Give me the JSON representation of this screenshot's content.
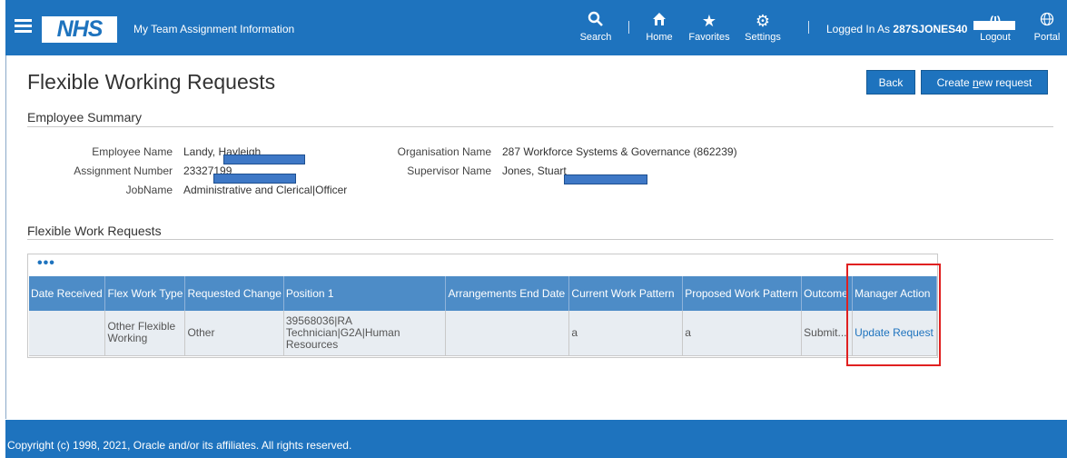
{
  "header": {
    "logo_text": "NHS",
    "app_title": "My Team Assignment Information",
    "nav": {
      "search": "Search",
      "home": "Home",
      "favorites": "Favorites",
      "settings": "Settings",
      "logout": "Logout",
      "portal": "Portal"
    },
    "logged_in_prefix": "Logged In As ",
    "logged_in_user": "287SJONES40"
  },
  "page": {
    "title": "Flexible Working Requests",
    "back_label": "Back",
    "create_label_pre": "Create ",
    "create_label_accel": "n",
    "create_label_post": "ew request"
  },
  "employee_summary": {
    "section_title": "Employee Summary",
    "employee_name_label": "Employee Name",
    "employee_name": "Landy, Hayleigh",
    "assignment_number_label": "Assignment Number",
    "assignment_number": "23327199",
    "job_name_label": "JobName",
    "job_name": "Administrative and Clerical|Officer",
    "organisation_name_label": "Organisation Name",
    "organisation_name": "287 Workforce Systems & Governance (862239)",
    "supervisor_name_label": "Supervisor Name",
    "supervisor_name": "Jones, Stuart"
  },
  "requests": {
    "section_title": "Flexible Work Requests",
    "more_actions": "•••",
    "columns": [
      "Date Received",
      "Flex Work Type",
      "Requested Change",
      "Position 1",
      "Arrangements End Date",
      "Current Work Pattern",
      "Proposed Work Pattern",
      "Outcome",
      "Manager Action"
    ],
    "rows": [
      {
        "date_received": "",
        "flex_work_type": "Other Flexible Working",
        "requested_change": "Other",
        "position_1": "39568036|RA Technician|G2A|Human Resources",
        "arrangements_end_date": "",
        "current_work_pattern": "a",
        "proposed_work_pattern": "a",
        "outcome": "Submit...",
        "manager_action": "Update Request"
      }
    ]
  },
  "footer": {
    "copyright": "Copyright (c) 1998, 2021, Oracle and/or its affiliates. All rights reserved."
  },
  "colors": {
    "brand_blue": "#1e73be",
    "table_header": "#4d8cc7",
    "highlight_red": "#e02020"
  }
}
